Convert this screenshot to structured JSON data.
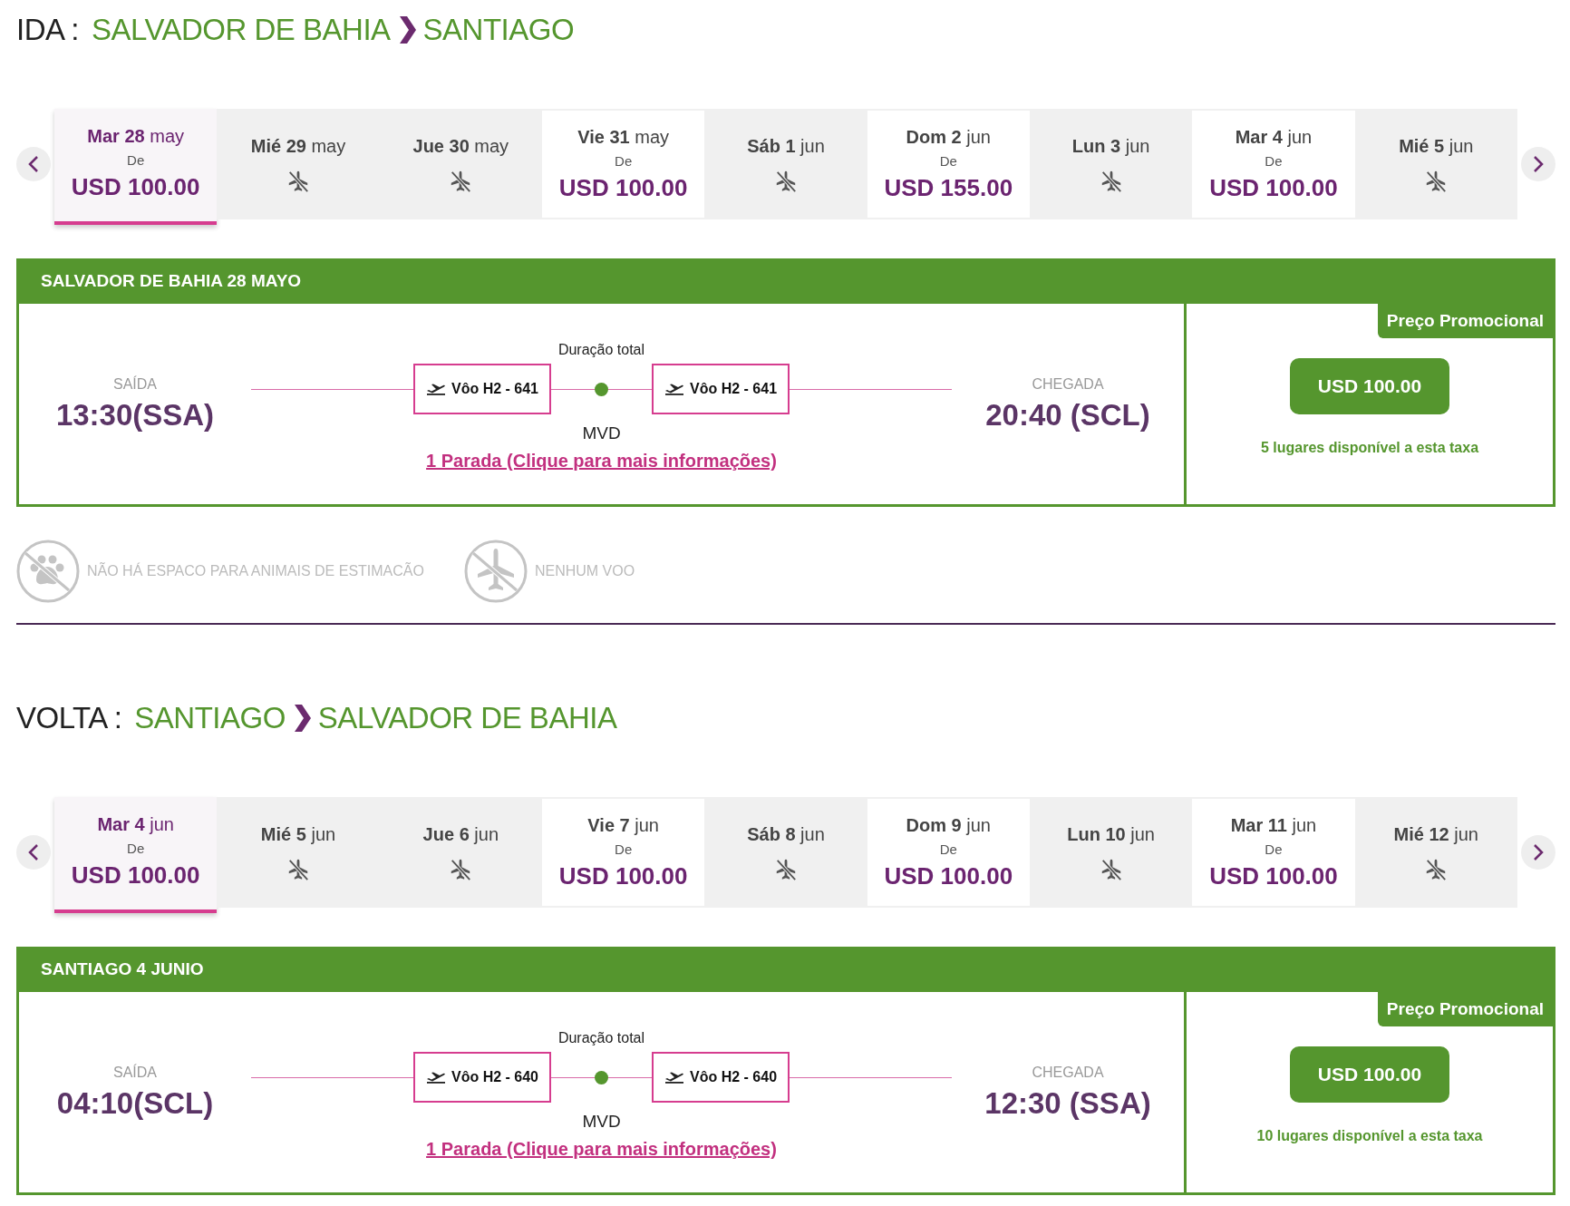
{
  "sections": [
    {
      "label": "IDA :",
      "origin": "SALVADOR DE BAHIA",
      "destination": "SANTIAGO",
      "dates": [
        {
          "weekday": "Mar",
          "day": "28",
          "month": "may",
          "kind": "priced",
          "from_label": "De",
          "price": "USD 100.00",
          "selected": true
        },
        {
          "weekday": "Mié",
          "day": "29",
          "month": "may",
          "kind": "noflight",
          "selected": false
        },
        {
          "weekday": "Jue",
          "day": "30",
          "month": "may",
          "kind": "noflight",
          "selected": false
        },
        {
          "weekday": "Vie",
          "day": "31",
          "month": "may",
          "kind": "priced",
          "from_label": "De",
          "price": "USD 100.00",
          "selected": false
        },
        {
          "weekday": "Sáb",
          "day": "1",
          "month": "jun",
          "kind": "noflight",
          "selected": false
        },
        {
          "weekday": "Dom",
          "day": "2",
          "month": "jun",
          "kind": "priced",
          "from_label": "De",
          "price": "USD 155.00",
          "selected": false
        },
        {
          "weekday": "Lun",
          "day": "3",
          "month": "jun",
          "kind": "noflight",
          "selected": false
        },
        {
          "weekday": "Mar",
          "day": "4",
          "month": "jun",
          "kind": "priced",
          "from_label": "De",
          "price": "USD 100.00",
          "selected": false
        },
        {
          "weekday": "Mié",
          "day": "5",
          "month": "jun",
          "kind": "noflight",
          "selected": false
        }
      ],
      "card": {
        "title": "SALVADOR DE BAHIA 28 MAYO",
        "departure_label": "SAÍDA",
        "departure_time": "13:30(SSA)",
        "duration_label": "Duração total",
        "legs": [
          "Vôo H2 - 641",
          "Vôo H2 - 641"
        ],
        "stop": "MVD",
        "stops_link": "1 Parada (Clique para mais informações)",
        "arrival_label": "CHEGADA",
        "arrival_time": "20:40 (SCL)",
        "promo_label": "Preço Promocional",
        "price": "USD 100.00",
        "availability": "5 lugares disponível a esta taxa"
      },
      "notices": [
        {
          "kind": "pets",
          "text": "NÃO HÁ ESPACO PARA ANIMAIS DE ESTIMACÃO"
        },
        {
          "kind": "flight",
          "text": "NENHUM VOO"
        }
      ]
    },
    {
      "label": "VOLTA :",
      "origin": "SANTIAGO",
      "destination": "SALVADOR DE BAHIA",
      "dates": [
        {
          "weekday": "Mar",
          "day": "4",
          "month": "jun",
          "kind": "priced",
          "from_label": "De",
          "price": "USD 100.00",
          "selected": true
        },
        {
          "weekday": "Mié",
          "day": "5",
          "month": "jun",
          "kind": "noflight",
          "selected": false
        },
        {
          "weekday": "Jue",
          "day": "6",
          "month": "jun",
          "kind": "noflight",
          "selected": false
        },
        {
          "weekday": "Vie",
          "day": "7",
          "month": "jun",
          "kind": "priced",
          "from_label": "De",
          "price": "USD 100.00",
          "selected": false
        },
        {
          "weekday": "Sáb",
          "day": "8",
          "month": "jun",
          "kind": "noflight",
          "selected": false
        },
        {
          "weekday": "Dom",
          "day": "9",
          "month": "jun",
          "kind": "priced",
          "from_label": "De",
          "price": "USD 100.00",
          "selected": false
        },
        {
          "weekday": "Lun",
          "day": "10",
          "month": "jun",
          "kind": "noflight",
          "selected": false
        },
        {
          "weekday": "Mar",
          "day": "11",
          "month": "jun",
          "kind": "priced",
          "from_label": "De",
          "price": "USD 100.00",
          "selected": false
        },
        {
          "weekday": "Mié",
          "day": "12",
          "month": "jun",
          "kind": "noflight",
          "selected": false
        }
      ],
      "card": {
        "title": "SANTIAGO 4 JUNIO",
        "departure_label": "SAÍDA",
        "departure_time": "04:10(SCL)",
        "duration_label": "Duração total",
        "legs": [
          "Vôo H2 - 640",
          "Vôo H2 - 640"
        ],
        "stop": "MVD",
        "stops_link": "1 Parada (Clique para mais informações)",
        "arrival_label": "CHEGADA",
        "arrival_time": "12:30 (SSA)",
        "promo_label": "Preço Promocional",
        "price": "USD 100.00",
        "availability": "10 lugares disponível a esta taxa"
      }
    }
  ]
}
